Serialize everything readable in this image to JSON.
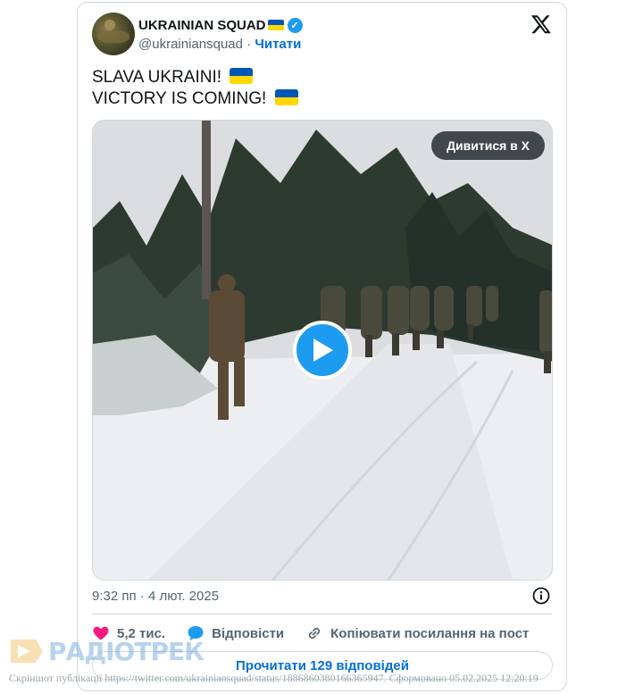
{
  "tweet": {
    "author_name": "UKRAINIAN SQUAD",
    "handle": "@ukrainiansquad",
    "separator": "·",
    "follow_label": "Читати",
    "text_line1": "SLAVA UKRAINI!",
    "text_line2": "VICTORY IS COMING!",
    "watch_label": "Дивитися в X",
    "time": "9:32 пп",
    "date": "4 лют. 2025",
    "likes_count": "5,2 тис.",
    "reply_label": "Відповісти",
    "copy_link_label": "Копіювати посилання на пост",
    "read_replies_label": "Прочитати 129 відповідей"
  },
  "watermark": {
    "logo_text": "РАДІОТРЕК",
    "caption": "Скріншот публікації https://twitter.com/ukrainiansquad/status/1886860380166365947. Сформовано 05.02.2025 12:20:19"
  },
  "colors": {
    "accent": "#1d9bf0",
    "link": "#006fd6",
    "like": "#f91880",
    "flag_blue": "#0057b7",
    "flag_yellow": "#ffd700"
  },
  "icons": {
    "x_logo": "x-logo-icon",
    "verified": "verified-badge-icon",
    "play": "play-icon",
    "info": "info-icon",
    "like": "heart-icon",
    "reply": "speech-bubble-icon",
    "copy": "link-icon"
  }
}
